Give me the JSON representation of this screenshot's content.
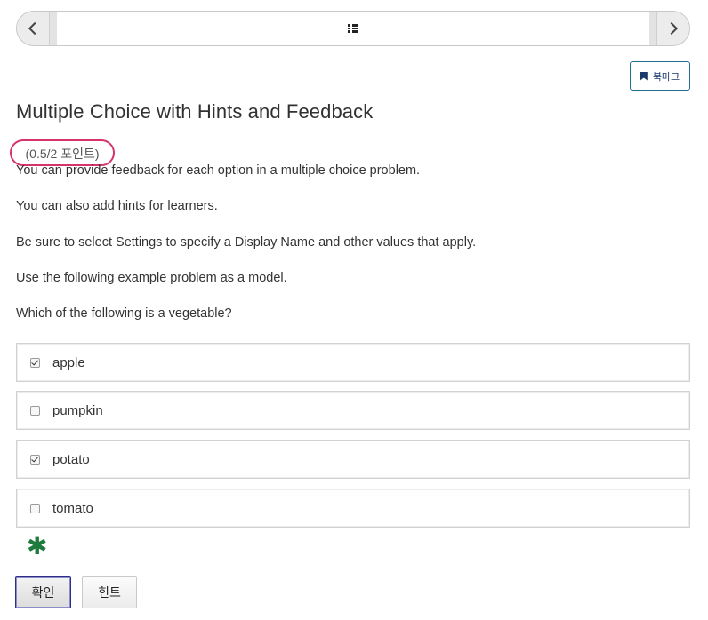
{
  "sequence_nav": {
    "prev_icon": "chevron-left-icon",
    "next_icon": "chevron-right-icon",
    "unit_icon": "list-icon"
  },
  "bookmark": {
    "label": "북마크",
    "icon": "bookmark-icon"
  },
  "problem": {
    "title": "Multiple Choice with Hints and Feedback",
    "points": "(0.5/2 포인트)",
    "paragraphs": [
      "You can provide feedback for each option in a multiple choice problem.",
      "You can also add hints for learners.",
      "Be sure to select Settings to specify a Display Name and other values that apply.",
      "Use the following example problem as a model.",
      "Which of the following is a vegetable?"
    ],
    "choices": [
      {
        "label": "apple",
        "checked": true
      },
      {
        "label": "pumpkin",
        "checked": false
      },
      {
        "label": "potato",
        "checked": true
      },
      {
        "label": "tomato",
        "checked": false
      }
    ],
    "status_icon": "partially-correct-asterisk-icon",
    "status_symbol": "✱",
    "highlight_color": "#d6336c",
    "status_color": "#1f7a3d"
  },
  "actions": {
    "submit_label": "확인",
    "hint_label": "힌트"
  }
}
